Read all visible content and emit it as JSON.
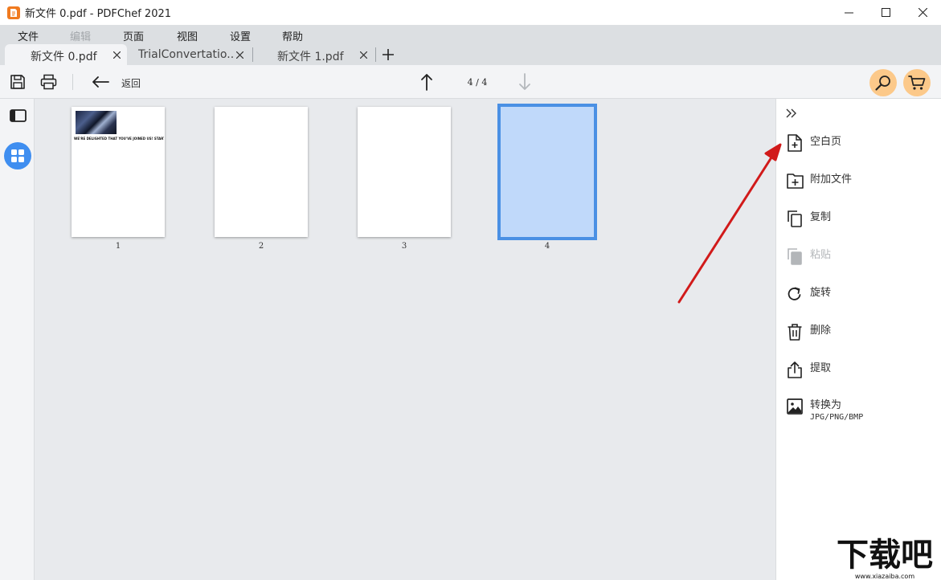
{
  "window": {
    "title": "新文件 0.pdf - PDFChef 2021",
    "app_logo_icon": "pdfchef-logo-icon",
    "controls": [
      "minimize-icon",
      "maximize-icon",
      "close-icon"
    ]
  },
  "menu": {
    "items": [
      {
        "label": "文件",
        "enabled": true
      },
      {
        "label": "编辑",
        "enabled": false
      },
      {
        "label": "页面",
        "enabled": true
      },
      {
        "label": "视图",
        "enabled": true
      },
      {
        "label": "设置",
        "enabled": true
      },
      {
        "label": "帮助",
        "enabled": true
      }
    ]
  },
  "tabs": {
    "items": [
      {
        "label": "新文件 0.pdf",
        "active": true
      },
      {
        "label": "TrialConvertatio...",
        "active": false
      },
      {
        "label": "新文件 1.pdf",
        "active": false
      }
    ],
    "add_icon": "plus-icon"
  },
  "toolbar": {
    "save_icon": "save-icon",
    "print_icon": "print-icon",
    "back_icon": "arrow-left-icon",
    "back_label": "返回",
    "prev_page_icon": "arrow-up-icon",
    "next_page_icon": "arrow-down-icon",
    "page_indicator": "4 / 4",
    "current_page": 4,
    "total_pages": 4,
    "search_icon": "search-icon",
    "cart_icon": "cart-icon",
    "accent_color": "#fcc98a"
  },
  "left_strip": {
    "panel_toggle_icon": "sidebar-panel-icon",
    "thumbnail_view_icon": "grid-view-icon",
    "active_color": "#3f8ef0"
  },
  "pages": {
    "items": [
      {
        "number": "1",
        "selected": false,
        "has_content": true,
        "text_line": "WE'RE DELIGHTED THAT YOU'VE JOINED US! START H"
      },
      {
        "number": "2",
        "selected": false,
        "has_content": false
      },
      {
        "number": "3",
        "selected": false,
        "has_content": false
      },
      {
        "number": "4",
        "selected": true,
        "has_content": false
      }
    ],
    "selection_color": "#4a90e4"
  },
  "right_panel": {
    "collapse_icon": "double-chevron-right-icon",
    "actions": [
      {
        "label": "空白页",
        "icon": "blank-page-icon",
        "enabled": true
      },
      {
        "label": "附加文件",
        "icon": "add-file-icon",
        "enabled": true
      },
      {
        "label": "复制",
        "icon": "copy-icon",
        "enabled": true
      },
      {
        "label": "粘贴",
        "icon": "paste-icon",
        "enabled": false
      },
      {
        "label": "旋转",
        "icon": "rotate-icon",
        "enabled": true
      },
      {
        "label": "删除",
        "icon": "trash-icon",
        "enabled": true
      },
      {
        "label": "提取",
        "icon": "extract-icon",
        "enabled": true
      },
      {
        "label": "转换为",
        "sublabel": "JPG/PNG/BMP",
        "icon": "image-convert-icon",
        "enabled": true
      }
    ]
  },
  "annotation": {
    "arrow_color": "#d11a1a"
  },
  "watermark": {
    "text": "下载吧",
    "url": "www.xiazaiba.com"
  }
}
